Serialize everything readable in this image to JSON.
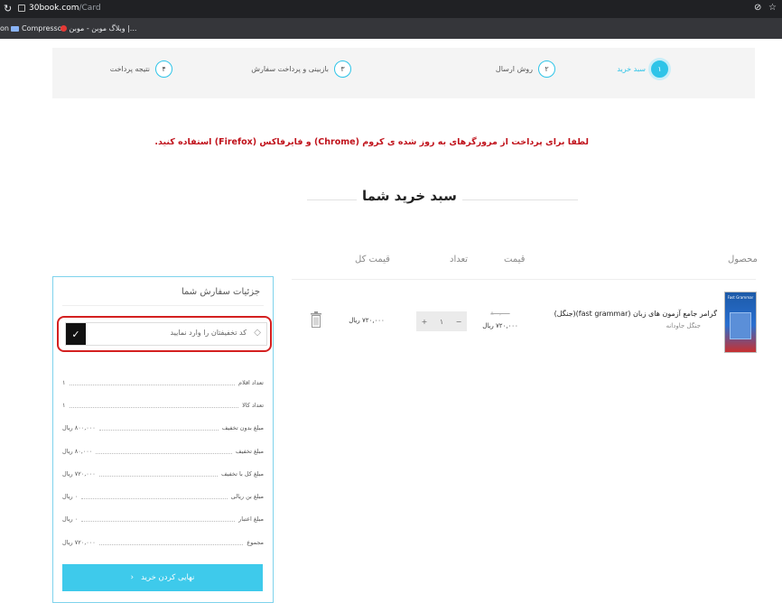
{
  "browser": {
    "url_host": "30book.com",
    "url_path": "/Card",
    "bookmarks": [
      {
        "label": "on"
      },
      {
        "label": "Compressor"
      },
      {
        "label": "وبلاگ موبن - موبن |..."
      }
    ]
  },
  "steps": [
    {
      "num": "۱",
      "label": "سبد خرید",
      "active": true
    },
    {
      "num": "۲",
      "label": "روش ارسال",
      "active": false
    },
    {
      "num": "۳",
      "label": "بازبینی و پرداخت سفارش",
      "active": false
    },
    {
      "num": "۴",
      "label": "نتیجه پرداخت",
      "active": false
    }
  ],
  "alert": "لطفا برای پرداخت از مرورگرهای به روز شده ی کروم (Chrome) و فایرفاکس (Firefox) استفاده کنید.",
  "cart_title": "سبد خرید شما",
  "table": {
    "headers": {
      "product": "محصول",
      "price": "قیمت",
      "qty": "تعداد",
      "total": "قیمت کل"
    },
    "item": {
      "book_cover_text": "Fast Grammar",
      "name": "گرامر جامع آزمون های زبان (fast grammar)(جنگل)",
      "publisher": "جنگل جاودانه",
      "price_old": "۸۰۰,۰۰۰",
      "price_new": "۷۲۰,۰۰۰ ریال",
      "qty": "۱",
      "qty_minus": "−",
      "qty_plus": "+",
      "total": "۷۲۰,۰۰۰ ریال"
    }
  },
  "order": {
    "title": "جزئیات سفارش شما",
    "coupon_placeholder": "کد تخفیفتان را وارد نمایید",
    "coupon_button": "✓",
    "rows": [
      {
        "label": "تعداد اقلام",
        "value": "۱"
      },
      {
        "label": "تعداد کالا",
        "value": "۱"
      },
      {
        "label": "مبلغ بدون تخفیف",
        "value": "۸۰۰,۰۰۰ ریال"
      },
      {
        "label": "مبلغ تخفیف",
        "value": "۸۰,۰۰۰ ریال"
      },
      {
        "label": "مبلغ کل با تخفیف",
        "value": "۷۲۰,۰۰۰ ریال"
      },
      {
        "label": "مبلغ بن ریالی",
        "value": "۰ ریال"
      },
      {
        "label": "مبلغ اعتبار",
        "value": "۰ ریال"
      },
      {
        "label": "مجموع",
        "value": "۷۲۰,۰۰۰ ریال"
      }
    ],
    "checkout_label": "نهایی کردن خرید",
    "checkout_chevron": "‹"
  }
}
